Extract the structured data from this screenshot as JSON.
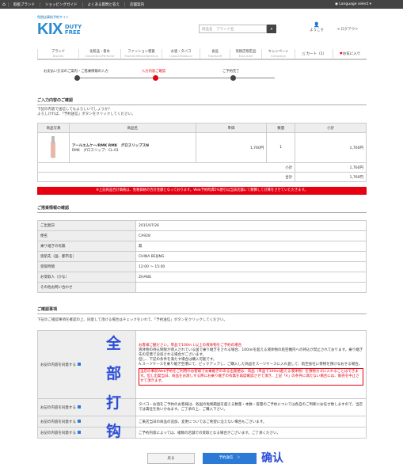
{
  "topbar": {
    "home_icon": "home-icon",
    "links": [
      "取扱ブランド",
      "ショッピングガイド",
      "よくある質問と答え",
      "店舗案内"
    ],
    "lang": "Language select ▾"
  },
  "header": {
    "tagline": "免税店事前予約サイト",
    "logo_kix": "KIX",
    "logo_duty": "DUTY",
    "logo_free": "FREE",
    "search_placeholder": "商品名　ブランド名",
    "welcome": "ようこそ",
    "logout": "ログアウト"
  },
  "nav": {
    "items": [
      {
        "ja": "ブランド",
        "en": "Brands"
      },
      {
        "ja": "化粧品・香水",
        "en": "Cosmetics/Perfume"
      },
      {
        "ja": "ファッション雑貨",
        "en": "Fashion/Miscellaneous"
      },
      {
        "ja": "お酒・タバコ",
        "en": "Liquor/Tobacco"
      },
      {
        "ja": "食品",
        "en": "Foodstuff"
      },
      {
        "ja": "免税店限定品",
        "en": "Exclusive"
      },
      {
        "ja": "キャンペーン",
        "en": "Campaign"
      }
    ],
    "cart": "カート（1）",
    "fav": "お気に入り"
  },
  "steps": {
    "s1": "お支払い方法のご案内・ご搭乗情報の入力",
    "s2": "入力内容ご確認",
    "s3": "ご予約完了"
  },
  "confirm": {
    "title": "ご入力内容のご確認",
    "desc1": "下記の内容で送信してもよろしいでしょうか?",
    "desc2": "よろしければ、「予約送信」ボタンをクリックしてください。"
  },
  "order": {
    "headers": [
      "商品写真",
      "商品名",
      "単価",
      "数量",
      "小計"
    ],
    "item_name": "アールエムケー/RMK RMK　グロスリップスN",
    "item_sub": "RMK　グロスリップ：CL-01",
    "unit": "1,760円",
    "qty": "1",
    "sub": "1,760円",
    "subtotal_label": "小計",
    "subtotal": "1,760円",
    "total_label": "合計",
    "total": "1,760円"
  },
  "notice": "※上記商品合計価格は、免税価格の合計金額となっております。Web予約時典5%割引は当該店舗にて精算して計算をさせていただきます。",
  "boarding": {
    "title": "ご搭乗情報の確認",
    "rows": [
      [
        "ご出発日",
        "2015/07/26"
      ],
      [
        "便名",
        "CA928"
      ],
      [
        "乗り継ぎの有無",
        "無"
      ],
      [
        "渡航先（国、都市名）",
        "CHINA BEIJING"
      ],
      [
        "受取時間",
        "12:00 ～ 15:00"
      ],
      [
        "お受取人（かな）",
        "ZHANG"
      ],
      [
        "その他お問い合わせ",
        ""
      ]
    ]
  },
  "terms": {
    "title": "ご確認事項",
    "desc": "下記のご確認事項を確認の上、同意して頂ける場合はチェックをいれて、「予約送信」ボタンをクリックしてください。",
    "agree": "お記の内容を同意する",
    "t1_head": "お客様ご観ださい。単品で100ｍｌ以上の液体物をご予約の場合",
    "t1_a": "液体物の持込制限が導入されている国で乗り継ぎをされる場合、100mlを超える液体物の航空機内への持込が禁止されております。乗り継ぎ先の空港で没収される場合がございます。",
    "t1_b": "但し、下記の条件を満たす場合は購入可能です。",
    "t1_c": "A.スーツケースを乗り継ぎ空港にて、ピックアップし、ご購入した商品をスーツケースに入れ直して、航空会社に荷物を預けなおせる場合。",
    "t1_red": "当店の事前Web予約をご利用のお客様でお乗継ぎのある出発便は、商品（単品で100ml超える液体物）を預物カゴに入れることはできます。但し出発当日、商品をお渡しする際にお乗り継ぎの有無を再度確認させて頂き、上記「A」の条件に満たない場合には、販売を中止させて頂きます。",
    "t2": "タバコ・お酒をご予約のお客様は、各国の免税範囲を超える数量・本数・容量のご予約については各自のご判断にお任せ致しますので、当店では責任を負いかねます。ご了承の上、ご購入下さい。",
    "t3": "ご来店当日の商品の追加、変更についてはご希望に沿えない場合もございます。",
    "t4": "ご予約内容によっては、複数の店舗での受取となる場合がございます。ご了承ください。"
  },
  "annotation": {
    "chars": [
      "全",
      "部",
      "打",
      "钩"
    ],
    "confirm": "确认"
  },
  "buttons": {
    "back": "戻る",
    "send": "予約送信　＞"
  }
}
